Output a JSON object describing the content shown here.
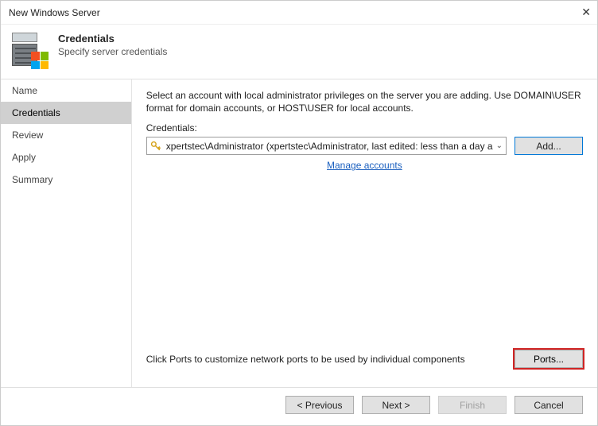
{
  "window": {
    "title": "New Windows Server",
    "close_label": "✕"
  },
  "header": {
    "title": "Credentials",
    "subtitle": "Specify server credentials"
  },
  "sidebar": {
    "items": [
      {
        "label": "Name",
        "active": false
      },
      {
        "label": "Credentials",
        "active": true
      },
      {
        "label": "Review",
        "active": false
      },
      {
        "label": "Apply",
        "active": false
      },
      {
        "label": "Summary",
        "active": false
      }
    ]
  },
  "main": {
    "instructions": "Select an account with local administrator privileges on the server you are adding. Use DOMAIN\\USER format for domain accounts, or HOST\\USER for local accounts.",
    "credentials_label": "Credentials:",
    "selected_credential": "xpertstec\\Administrator (xpertstec\\Administrator, last edited: less than a day a",
    "add_button": "Add...",
    "manage_link": "Manage accounts",
    "ports_text": "Click Ports to customize network ports to be used by individual components",
    "ports_button": "Ports..."
  },
  "footer": {
    "previous": "< Previous",
    "next": "Next >",
    "finish": "Finish",
    "cancel": "Cancel"
  },
  "colors": {
    "accent_blue": "#0078d7",
    "highlight_red": "#d02424",
    "link_blue": "#1a5fbf"
  }
}
